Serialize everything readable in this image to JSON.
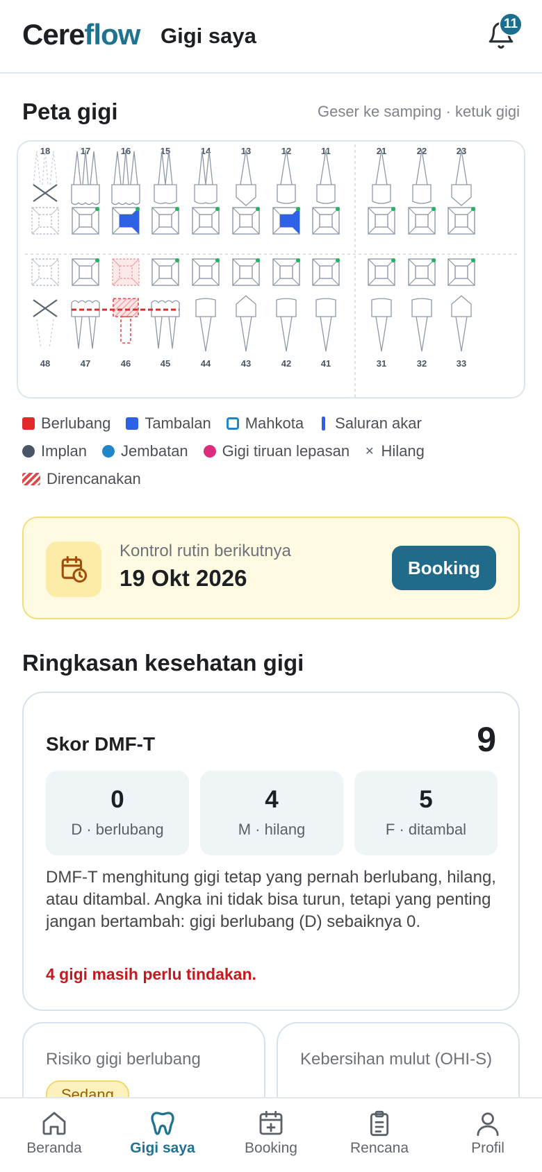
{
  "header": {
    "logo_left": "Cere",
    "logo_right": "flow",
    "title": "Gigi saya",
    "notification_count": "11"
  },
  "tooth_map": {
    "title": "Peta gigi",
    "hint": "Geser ke samping · ketuk gigi",
    "upper_teeth": [
      "18",
      "17",
      "16",
      "15",
      "14",
      "13",
      "12",
      "11",
      "21",
      "22",
      "23"
    ],
    "lower_teeth": [
      "48",
      "47",
      "46",
      "45",
      "44",
      "43",
      "42",
      "41",
      "31",
      "32",
      "33"
    ],
    "upper_status": [
      "missing",
      "sound",
      "filling",
      "sound",
      "sound",
      "sound",
      "filling",
      "sound",
      "sound",
      "sound",
      "sound"
    ],
    "lower_status": [
      "missing",
      "bridge",
      "planned",
      "sound",
      "sound",
      "sound",
      "sound",
      "sound",
      "sound",
      "sound",
      "sound"
    ],
    "colors": {
      "caries": "#e02a2a",
      "filling": "#2e62e6",
      "crown": "#1f86c9",
      "root_canal": "#2e62e6",
      "implant": "#4b5568",
      "bridge": "#1f86c9",
      "denture": "#dd2b7f",
      "planned": "#e0484b",
      "outline": "#8c98a8",
      "status_ok": "#22b35e"
    }
  },
  "legend": [
    [
      {
        "label": "Berlubang",
        "icon": "caries-swatch"
      },
      {
        "label": "Tambalan",
        "icon": "filling-swatch"
      },
      {
        "label": "Mahkota",
        "icon": "crown-swatch"
      },
      {
        "label": "Saluran akar",
        "icon": "root-canal-swatch"
      }
    ],
    [
      {
        "label": "Implan",
        "icon": "implant-swatch"
      },
      {
        "label": "Jembatan",
        "icon": "bridge-swatch"
      },
      {
        "label": "Gigi tiruan lepasan",
        "icon": "denture-swatch"
      },
      {
        "label": "Hilang",
        "icon": "missing-swatch"
      }
    ],
    [
      {
        "label": "Direncanakan",
        "icon": "planned-swatch"
      }
    ]
  ],
  "next_control": {
    "label": "Kontrol rutin berikutnya",
    "date": "19 Okt 2026",
    "button": "Booking"
  },
  "summary": {
    "title": "Ringkasan kesehatan gigi",
    "dmf_label": "Skor DMF-T",
    "dmf_score": "9",
    "stats": [
      {
        "value": "0",
        "label": "D · berlubang"
      },
      {
        "value": "4",
        "label": "M · hilang"
      },
      {
        "value": "5",
        "label": "F · ditambal"
      }
    ],
    "description": "DMF-T menghitung gigi tetap yang pernah berlubang, hilang, atau ditambal. Angka ini tidak bisa turun, tetapi yang penting jangan bertambah: gigi berlubang (D) sebaiknya 0.",
    "warning": "4 gigi masih perlu tindakan."
  },
  "risk_card": {
    "title": "Risiko gigi berlubang",
    "level": "Sedang"
  },
  "hygiene_card": {
    "title": "Kebersihan mulut (OHI-S)"
  },
  "nav": [
    {
      "label": "Beranda",
      "icon": "home-icon"
    },
    {
      "label": "Gigi saya",
      "icon": "tooth-icon",
      "active": true
    },
    {
      "label": "Booking",
      "icon": "calendar-plus-icon"
    },
    {
      "label": "Rencana",
      "icon": "clipboard-icon"
    },
    {
      "label": "Profil",
      "icon": "user-icon"
    }
  ]
}
